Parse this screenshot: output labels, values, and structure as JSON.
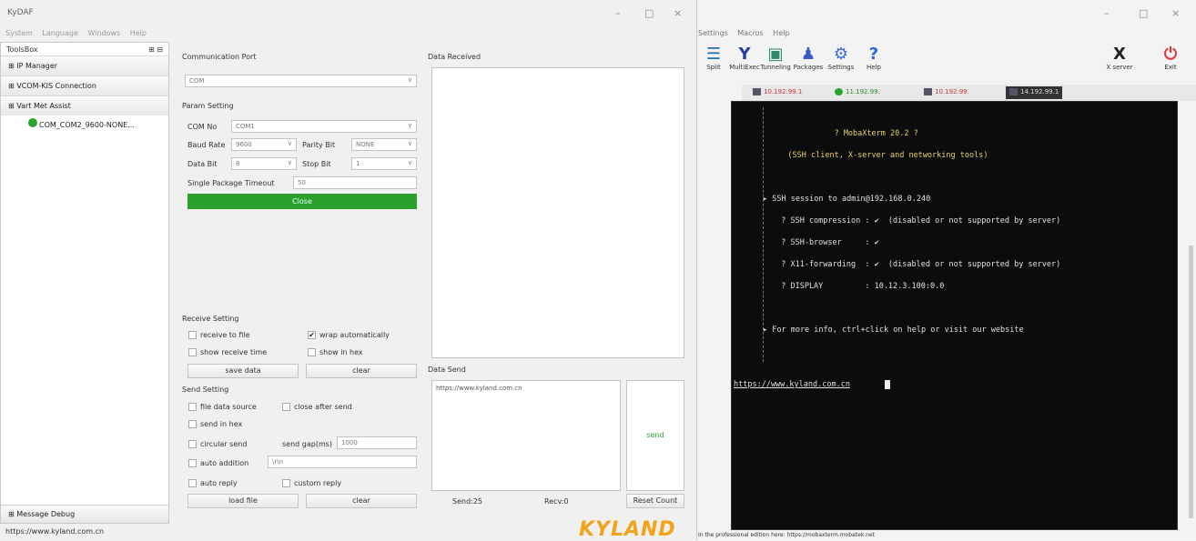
{
  "left_app": {
    "title": "KyDAF",
    "menu": [
      "System",
      "Language",
      "Windows",
      "Help"
    ],
    "toolbox": {
      "header": "ToolsBox",
      "header_icons": "⊞ ⊟",
      "items": [
        "⊞ IP Manager",
        "⊞ VCOM-KIS Connection",
        "⊞ Vart Met Assist"
      ],
      "sub_item": "COM_COM2_9600-NONE...",
      "bottom": "⊞ Message Debug"
    },
    "status_url": "https://www.kyland.com.cn",
    "comm_port": {
      "label": "Communication Port",
      "value": "COM"
    },
    "param": {
      "label": "Param Setting",
      "com_no_label": "COM No",
      "com_no": "COM1",
      "baud_label": "Baud Rate",
      "baud": "9600",
      "parity_label": "Parity Bit",
      "parity": "NONE",
      "data_bit_label": "Data Bit",
      "data_bit": "8",
      "stop_bit_label": "Stop Bit",
      "stop_bit": "1",
      "single_label": "Single Package Timeout",
      "single": "50",
      "close_btn": "Close"
    },
    "receive": {
      "label": "Receive Setting",
      "to_file": "receive to file",
      "wrap": "wrap automatically",
      "show_time": "show receive time",
      "show_hex": "show in hex",
      "save": "save data",
      "clear": "clear"
    },
    "send_set": {
      "label": "Send Setting",
      "file_src": "file data source",
      "close_after": "close after send",
      "send_hex": "send in hex",
      "circular": "circular send",
      "gap_label": "send gap(ms)",
      "gap": "1000",
      "auto_add": "auto addition",
      "auto_add_val": "\\r\\n",
      "auto_reply": "auto reply",
      "custom_reply": "custom reply",
      "load": "load file",
      "clear": "clear"
    },
    "data_received": {
      "label": "Data Received"
    },
    "data_send": {
      "label": "Data Send",
      "value": "https://www.kyland.com.cn",
      "send_btn": "send"
    },
    "counters": {
      "send": "Send:25",
      "recv": "Recv:0",
      "reset": "Reset Count"
    },
    "brand": "KYLAND",
    "window_controls": [
      "–",
      "□",
      "×"
    ]
  },
  "right_app": {
    "menu": [
      "Settings",
      "Macros",
      "Help"
    ],
    "tools": [
      {
        "icon": "☰",
        "label": "Split",
        "color": "#2a6ab8"
      },
      {
        "icon": "Y",
        "label": "MultiExec",
        "color": "#2a3a9c"
      },
      {
        "icon": "▣",
        "label": "Tunneling",
        "color": "#2c8a6a"
      },
      {
        "icon": "♟",
        "label": "Packages",
        "color": "#3a5ac8"
      },
      {
        "icon": "⚙",
        "label": "Settings",
        "color": "#3a6ad8"
      },
      {
        "icon": "?",
        "label": "Help",
        "color": "#2a6ad8"
      },
      {
        "icon": "X",
        "label": "X server",
        "color": "#222"
      },
      {
        "icon": "⏻",
        "label": "Exit",
        "color": "#e03c3c"
      }
    ],
    "tabs": [
      "10.192.99.1",
      "11.192.99.",
      "10.192.99.",
      "14.192.99.1"
    ],
    "terminal": [
      {
        "t": "                      ? MobaXterm 20.2 ?",
        "c": "#e8d36a"
      },
      {
        "t": "            (SSH client, X-server and networking tools)",
        "c": "#e8d36a"
      },
      {
        "t": "▸ SSH session to admin@192.168.0.240",
        "c": "#e0e0e0"
      },
      {
        "t": "  ? SSH compression : ✔  (disabled or not supported by server)",
        "c": "#e0e0e0"
      },
      {
        "t": "  ? SSH-browser     : ✔",
        "c": "#e0e0e0"
      },
      {
        "t": "  ? X11-forwarding  : ✔  (disabled or not supported by server)",
        "c": "#e0e0e0"
      },
      {
        "t": "  ? DISPLAY         : 10.12.3.100:0.0",
        "c": "#e0e0e0"
      },
      {
        "t": "▸ For more info, ctrl+click on help or visit our website",
        "c": "#e0e0e0"
      }
    ],
    "prompt": "https://www.kyland.com.cn",
    "status": "In the professional edition here: https://mobaxterm.mobatek.net",
    "window_controls": [
      "–",
      "□",
      "×"
    ]
  }
}
